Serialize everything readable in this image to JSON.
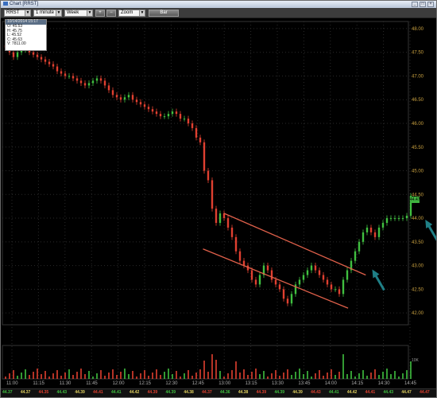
{
  "window": {
    "title": "Chart [RRST]"
  },
  "toolbar": {
    "symbol": "RRST",
    "interval": "1 minute",
    "range": "Week",
    "btn_plus": "+",
    "btn_minus": "−",
    "zoom": "Zoom",
    "bar": "Bar"
  },
  "ohlc_box": {
    "header": "10/14/2014 15:17",
    "rows": [
      "O: 45.53",
      "H: 45.75",
      "L: 45.52",
      "C: 45.63",
      "V: 7811.00"
    ]
  },
  "colors": {
    "up": "#40c040",
    "down": "#e04030",
    "trendline": "#e0604a",
    "arrow": "#1f7f86",
    "axis_text": "#c8a040",
    "grid": "#2a2a2a"
  },
  "last_price_tag": "44.47",
  "volume_axis_label": "10K",
  "chart_data": {
    "type": "candlestick",
    "x_ticks": [
      "11:00",
      "11:15",
      "11:30",
      "11:45",
      "12:00",
      "12:15",
      "12:30",
      "12:45",
      "13:00",
      "13:15",
      "13:30",
      "13:45",
      "14:00",
      "14:15",
      "14:30",
      "14:45"
    ],
    "y_ticks": [
      "48.00",
      "47.50",
      "47.00",
      "46.50",
      "46.00",
      "45.50",
      "45.00",
      "44.50",
      "44.00",
      "43.50",
      "43.00",
      "42.50",
      "42.00"
    ],
    "ylim": [
      41.75,
      48.15
    ],
    "volume_ticks": [
      "10K"
    ],
    "close_series": [
      47.6,
      47.5,
      47.4,
      47.5,
      47.55,
      47.6,
      47.5,
      47.45,
      47.4,
      47.35,
      47.3,
      47.25,
      47.2,
      47.1,
      47.05,
      47.0,
      47.0,
      46.95,
      46.9,
      46.85,
      46.8,
      46.85,
      46.9,
      46.95,
      46.9,
      46.8,
      46.7,
      46.6,
      46.55,
      46.5,
      46.55,
      46.6,
      46.5,
      46.45,
      46.4,
      46.35,
      46.3,
      46.25,
      46.2,
      46.15,
      46.15,
      46.2,
      46.25,
      46.2,
      46.1,
      46.1,
      46.0,
      45.9,
      45.7,
      45.6,
      45.0,
      44.8,
      44.2,
      43.9,
      44.1,
      44.0,
      43.8,
      43.6,
      43.3,
      43.1,
      43.0,
      42.9,
      42.7,
      42.6,
      42.8,
      43.0,
      42.9,
      42.7,
      42.6,
      42.5,
      42.3,
      42.2,
      42.4,
      42.6,
      42.7,
      42.8,
      42.9,
      43.0,
      42.9,
      42.8,
      42.7,
      42.6,
      42.5,
      42.5,
      42.4,
      42.7,
      42.9,
      43.1,
      43.3,
      43.5,
      43.7,
      43.8,
      43.7,
      43.6,
      43.8,
      43.9,
      44.0,
      44.0,
      44.0,
      44.0,
      44.0,
      44.05,
      44.47
    ],
    "price_labels": [
      "44.37",
      "44.37",
      "44.35",
      "44.43",
      "44.39",
      "44.41",
      "44.41",
      "44.42",
      "44.39",
      "44.39",
      "44.38",
      "44.37",
      "44.36",
      "44.38",
      "44.39",
      "44.39",
      "44.39",
      "44.43",
      "44.41",
      "44.42",
      "44.41",
      "44.43",
      "44.47",
      "44.47"
    ],
    "annotations": [
      {
        "type": "trendline",
        "from": [
          "13:00",
          44.1
        ],
        "to": [
          "14:20",
          42.8
        ]
      },
      {
        "type": "trendline",
        "from": [
          "12:48",
          43.35
        ],
        "to": [
          "14:10",
          42.1
        ]
      },
      {
        "type": "arrow",
        "at": "14:25",
        "points_to": 42.85
      },
      {
        "type": "arrow",
        "at": "14:55",
        "points_to": 43.9
      }
    ]
  }
}
